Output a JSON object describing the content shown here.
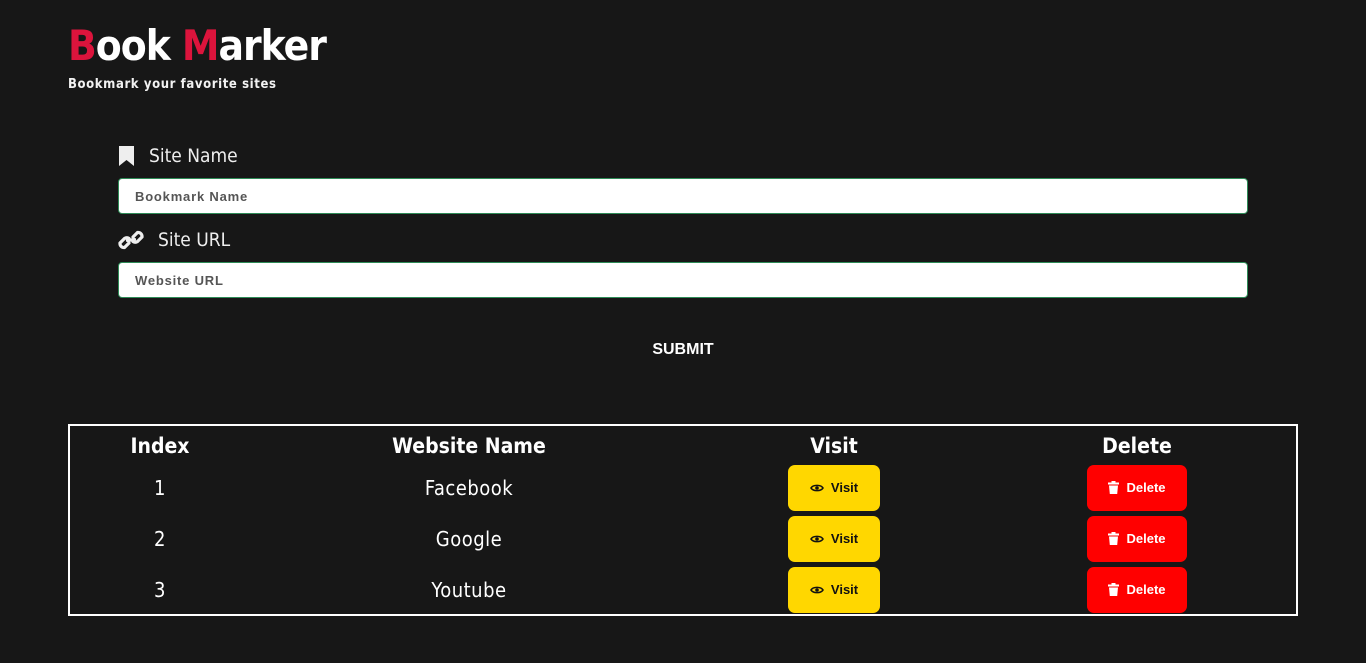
{
  "header": {
    "title_word1_first": "B",
    "title_word1_rest": "ook",
    "title_word2_first": "M",
    "title_word2_rest": "arker",
    "subtitle": "Bookmark your favorite sites"
  },
  "form": {
    "site_name_label": "Site Name",
    "site_name_placeholder": "Bookmark Name",
    "site_url_label": "Site URL",
    "site_url_placeholder": "Website URL",
    "submit_label": "SUBMIT"
  },
  "table": {
    "headers": [
      "Index",
      "Website Name",
      "Visit",
      "Delete"
    ],
    "rows": [
      {
        "index": "1",
        "name": "Facebook",
        "visit": "Visit",
        "delete": "Delete"
      },
      {
        "index": "2",
        "name": "Google",
        "visit": "Visit",
        "delete": "Delete"
      },
      {
        "index": "3",
        "name": "Youtube",
        "visit": "Visit",
        "delete": "Delete"
      }
    ]
  },
  "icons": {
    "site_name": "bookmark-icon",
    "site_url": "link-icon",
    "visit": "eye-icon",
    "delete": "trash-icon"
  },
  "colors": {
    "background": "#171717",
    "accent": "#dc143c",
    "visit_button": "#ffd700",
    "delete_button": "#ff0000"
  }
}
